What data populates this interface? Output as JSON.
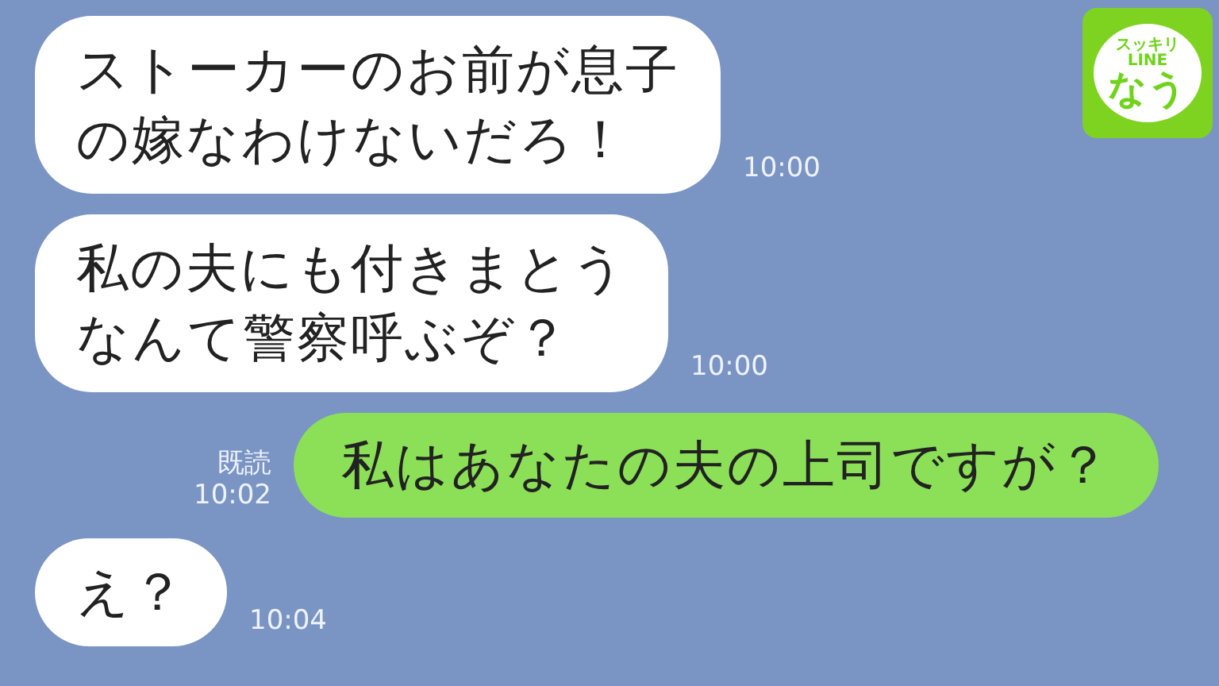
{
  "logo": {
    "line_1": "スッキリ",
    "line_2": "LINE",
    "line_3": "なう"
  },
  "messages": [
    {
      "kind": "incoming",
      "lines": [
        "ストーカーのお前が息子",
        "の嫁なわけないだろ！"
      ],
      "time": "10:00"
    },
    {
      "kind": "incoming",
      "lines": [
        "私の夫にも付きまとう",
        "なんて警察呼ぶぞ？"
      ],
      "time": "10:00"
    },
    {
      "kind": "outgoing",
      "lines": [
        "私はあなたの夫の上司ですが？"
      ],
      "time": "10:02",
      "read": "既読"
    },
    {
      "kind": "incoming",
      "lines": [
        "え？"
      ],
      "time": "10:04"
    }
  ]
}
